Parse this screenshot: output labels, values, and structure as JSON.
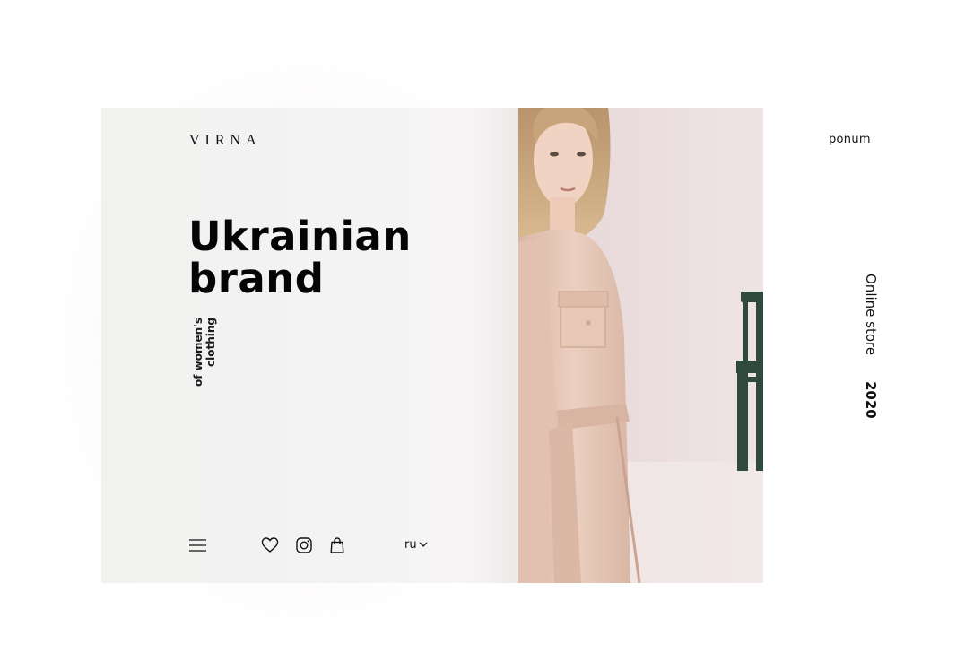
{
  "brand": {
    "logo": "VIRNA"
  },
  "hero": {
    "title_line1": "Ukrainian",
    "title_line2": "brand",
    "subtitle_line1": "of women's",
    "subtitle_line2": "clothing"
  },
  "bottom_bar": {
    "menu_icon": "hamburger-menu-icon",
    "icons": [
      "heart-icon",
      "instagram-icon",
      "shopping-bag-icon"
    ],
    "language": "ru",
    "language_icon": "chevron-down-icon"
  },
  "side": {
    "partner_logo": "ponum",
    "online_store": "Online store",
    "year": "2020"
  },
  "colors": {
    "panel_bg": "#f2f1f0",
    "photo_bg": "#eadcdc",
    "outfit": "#e7cbbd",
    "chair": "#2f4a3c",
    "text": "#0a0a0a"
  }
}
